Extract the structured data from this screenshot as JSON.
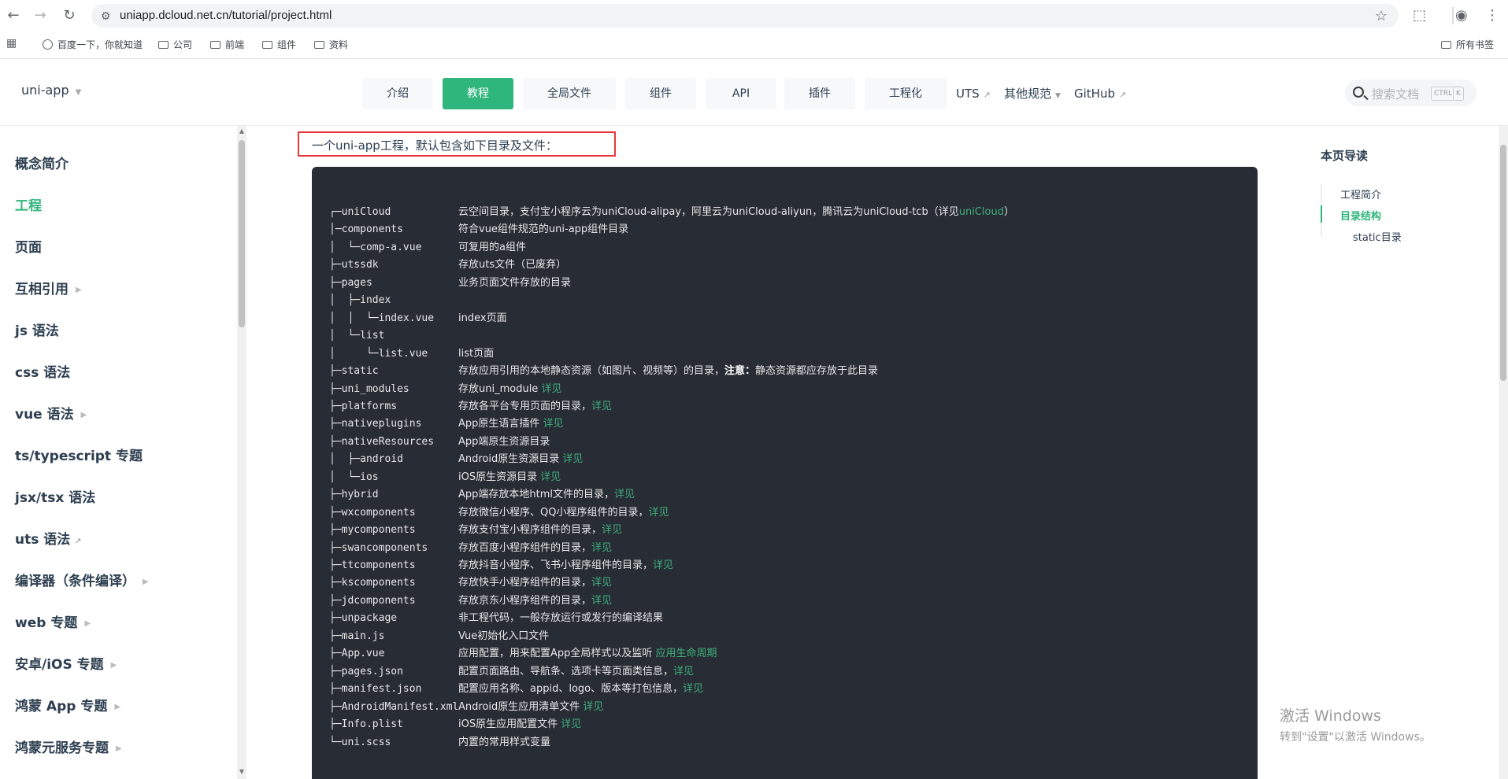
{
  "browser": {
    "url": "uniapp.dcloud.net.cn/tutorial/project.html",
    "bookmarks": [
      "百度一下，你就知道",
      "公司",
      "前端",
      "组件",
      "资料"
    ],
    "all_bookmarks": "所有书签"
  },
  "header": {
    "brand": "uni-app",
    "nav": [
      "介绍",
      "教程",
      "全局文件",
      "组件",
      "API",
      "插件",
      "工程化"
    ],
    "nav_active": "教程",
    "nav_plain": [
      "UTS",
      "其他规范",
      "GitHub"
    ],
    "search_placeholder": "搜索文档",
    "kbd_ctrl": "CTRL",
    "kbd_k": "K"
  },
  "sidebar": {
    "items": [
      "概念简介",
      "工程",
      "页面",
      "互相引用",
      "js 语法",
      "css 语法",
      "vue 语法",
      "ts/typescript 专题",
      "jsx/tsx 语法",
      "uts 语法",
      "编译器（条件编译）",
      "web 专题",
      "安卓/iOS 专题",
      "鸿蒙 App 专题",
      "鸿蒙元服务专题"
    ],
    "active": "工程"
  },
  "content": {
    "intro": "一个uni-app工程，默认包含如下目录及文件：",
    "tree": [
      {
        "path": "┌─uniCloud",
        "desc": "云空间目录，支付宝小程序云为uniCloud-alipay，阿里云为uniCloud-aliyun，腾讯云为uniCloud-tcb（详见",
        "link": "uniCloud",
        "tail": "）"
      },
      {
        "path": "│─components",
        "desc": "符合vue组件规范的uni-app组件目录",
        "link": "",
        "tail": ""
      },
      {
        "path": "│  └─comp-a.vue",
        "desc": "可复用的a组件",
        "link": "",
        "tail": ""
      },
      {
        "path": "├─utssdk",
        "desc": "存放uts文件（已废弃）",
        "link": "",
        "tail": ""
      },
      {
        "path": "├─pages",
        "desc": "业务页面文件存放的目录",
        "link": "",
        "tail": ""
      },
      {
        "path": "│  ├─index",
        "desc": "",
        "link": "",
        "tail": ""
      },
      {
        "path": "│  │  └─index.vue",
        "desc": "index页面",
        "link": "",
        "tail": ""
      },
      {
        "path": "│  └─list",
        "desc": "",
        "link": "",
        "tail": ""
      },
      {
        "path": "│     └─list.vue",
        "desc": "list页面",
        "link": "",
        "tail": ""
      },
      {
        "path": "├─static",
        "desc": "存放应用引用的本地静态资源（如图片、视频等）的目录，",
        "bold": "注意：",
        "link": "",
        "tail": "静态资源都应存放于此目录"
      },
      {
        "path": "├─uni_modules",
        "desc": "存放uni_module ",
        "link": "详见",
        "tail": ""
      },
      {
        "path": "├─platforms",
        "desc": "存放各平台专用页面的目录，",
        "link": "详见",
        "tail": ""
      },
      {
        "path": "├─nativeplugins",
        "desc": "App原生语言插件 ",
        "link": "详见",
        "tail": ""
      },
      {
        "path": "├─nativeResources",
        "desc": "App端原生资源目录",
        "link": "",
        "tail": ""
      },
      {
        "path": "│  ├─android",
        "desc": "Android原生资源目录 ",
        "link": "详见",
        "tail": ""
      },
      {
        "path": "│  └─ios",
        "desc": "iOS原生资源目录 ",
        "link": "详见",
        "tail": ""
      },
      {
        "path": "├─hybrid",
        "desc": "App端存放本地html文件的目录，",
        "link": "详见",
        "tail": ""
      },
      {
        "path": "├─wxcomponents",
        "desc": "存放微信小程序、QQ小程序组件的目录，",
        "link": "详见",
        "tail": ""
      },
      {
        "path": "├─mycomponents",
        "desc": "存放支付宝小程序组件的目录，",
        "link": "详见",
        "tail": ""
      },
      {
        "path": "├─swancomponents",
        "desc": "存放百度小程序组件的目录，",
        "link": "详见",
        "tail": ""
      },
      {
        "path": "├─ttcomponents",
        "desc": "存放抖音小程序、飞书小程序组件的目录，",
        "link": "详见",
        "tail": ""
      },
      {
        "path": "├─kscomponents",
        "desc": "存放快手小程序组件的目录，",
        "link": "详见",
        "tail": ""
      },
      {
        "path": "├─jdcomponents",
        "desc": "存放京东小程序组件的目录，",
        "link": "详见",
        "tail": ""
      },
      {
        "path": "├─unpackage",
        "desc": "非工程代码，一般存放运行或发行的编译结果",
        "link": "",
        "tail": ""
      },
      {
        "path": "├─main.js",
        "desc": "Vue初始化入口文件",
        "link": "",
        "tail": ""
      },
      {
        "path": "├─App.vue",
        "desc": "应用配置，用来配置App全局样式以及监听 ",
        "link": "应用生命周期",
        "tail": ""
      },
      {
        "path": "├─pages.json",
        "desc": "配置页面路由、导航条、选项卡等页面类信息，",
        "link": "详见",
        "tail": ""
      },
      {
        "path": "├─manifest.json",
        "desc": "配置应用名称、appid、logo、版本等打包信息，",
        "link": "详见",
        "tail": ""
      },
      {
        "path": "├─AndroidManifest.xml",
        "desc": "Android原生应用清单文件 ",
        "link": "详见",
        "tail": ""
      },
      {
        "path": "├─Info.plist",
        "desc": "iOS原生应用配置文件 ",
        "link": "详见",
        "tail": ""
      },
      {
        "path": "└─uni.scss",
        "desc": "内置的常用样式变量",
        "link": "",
        "tail": ""
      }
    ]
  },
  "toc": {
    "title": "本页导读",
    "items": [
      "工程简介",
      "目录结构",
      "static目录"
    ],
    "active": "目录结构"
  },
  "watermark": {
    "line1": "激活 Windows",
    "line2": "转到\"设置\"以激活 Windows。"
  }
}
